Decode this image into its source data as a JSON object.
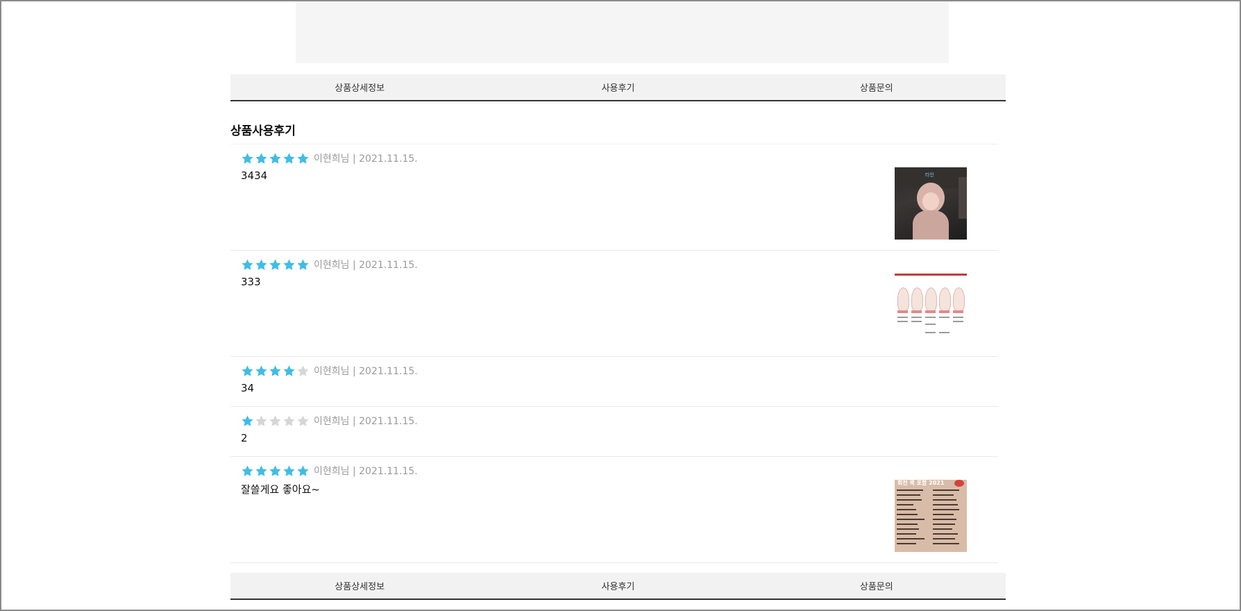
{
  "tabs": {
    "detail": "상품상세정보",
    "reviews": "사용후기",
    "inquiry": "상품문의"
  },
  "section_title": "상품사용후기",
  "colors": {
    "star_on": "#3fbde6",
    "star_off": "#d6d6d6",
    "tab_bg": "#f2f2f2"
  },
  "reviews": [
    {
      "rating": 5,
      "author": "이현희님",
      "date": "2021.11.15.",
      "byline": "이현희님 | 2021.11.15.",
      "content": "3434",
      "has_image": true
    },
    {
      "rating": 5,
      "author": "이현희님",
      "date": "2021.11.15.",
      "byline": "이현희님 | 2021.11.15.",
      "content": "333",
      "has_image": true
    },
    {
      "rating": 4,
      "author": "이현희님",
      "date": "2021.11.15.",
      "byline": "이현희님 | 2021.11.15.",
      "content": "34",
      "has_image": false
    },
    {
      "rating": 1,
      "author": "이현희님",
      "date": "2021.11.15.",
      "byline": "이현희님 | 2021.11.15.",
      "content": "2",
      "has_image": false
    },
    {
      "rating": 5,
      "author": "이현희님",
      "date": "2021.11.15.",
      "byline": "이현희님 | 2021.11.15.",
      "content": "잘쓸게요 좋아요~",
      "has_image": true
    }
  ],
  "thumbnails": {
    "photo_caption": "타인",
    "list_title": "회전 쿡 포함 2021"
  }
}
